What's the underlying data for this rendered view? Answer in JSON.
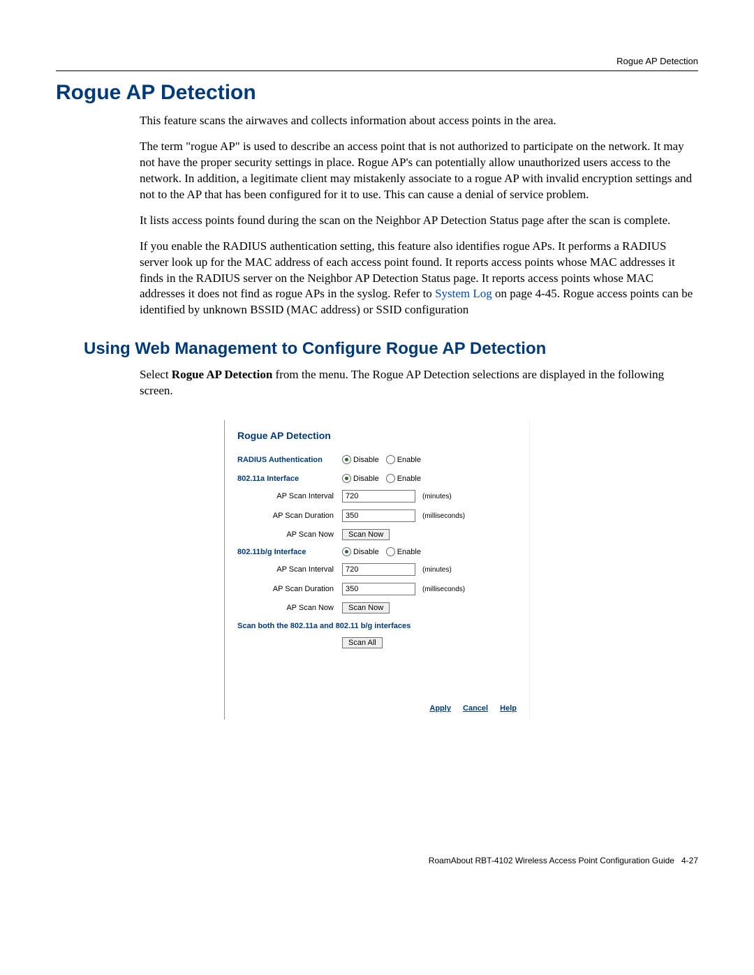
{
  "header": {
    "section_label": "Rogue AP Detection"
  },
  "h1": "Rogue AP Detection",
  "paragraphs": {
    "p1": "This feature scans the airwaves and collects information about access points in the area.",
    "p2": "The term \"rogue AP\" is used to describe an access point that is not authorized to participate on the network. It may not have the proper security settings in place. Rogue AP's can potentially allow unauthorized users access to the network. In addition, a legitimate client may mistakenly associate to a rogue AP with invalid encryption settings and not to the AP that has been configured for it to use. This can cause a denial of service problem.",
    "p3": "It lists access points found during the scan on the Neighbor AP Detection Status page after the scan is complete.",
    "p4a": "If you enable the RADIUS authentication setting, this feature also identifies rogue APs. It performs a RADIUS server look up for the MAC address of each access point found. It reports access points whose MAC addresses it finds in the RADIUS server on the Neighbor AP Detection Status page. It reports access points whose MAC addresses it does not find as rogue APs in the syslog. Refer to ",
    "p4_link": "System Log",
    "p4b": " on page 4-45. Rogue access points can be identified by unknown BSSID (MAC address) or SSID configuration"
  },
  "h2": "Using Web Management to Configure Rogue AP Detection",
  "p5a": "Select ",
  "p5b": "Rogue AP Detection",
  "p5c": " from the menu. The Rogue AP Detection selections are displayed in the following screen.",
  "screenshot": {
    "title": "Rogue AP Detection",
    "radius_label": "RADIUS Authentication",
    "disable": "Disable",
    "enable": "Enable",
    "iface_a": "802.11a Interface",
    "iface_bg": "802.11b/g Interface",
    "scan_interval_label": "AP Scan Interval",
    "scan_duration_label": "AP Scan Duration",
    "scan_now_label": "AP Scan Now",
    "interval_val_a": "720",
    "duration_val_a": "350",
    "interval_val_bg": "720",
    "duration_val_bg": "350",
    "unit_min": "(minutes)",
    "unit_ms": "(milliseconds)",
    "scan_now_btn": "Scan Now",
    "scan_both_label": "Scan both the 802.11a and 802.11 b/g interfaces",
    "scan_all_btn": "Scan All",
    "apply": "Apply",
    "cancel": "Cancel",
    "help": "Help"
  },
  "footer": {
    "text": "RoamAbout RBT-4102 Wireless Access Point Configuration Guide",
    "page": "4-27"
  }
}
